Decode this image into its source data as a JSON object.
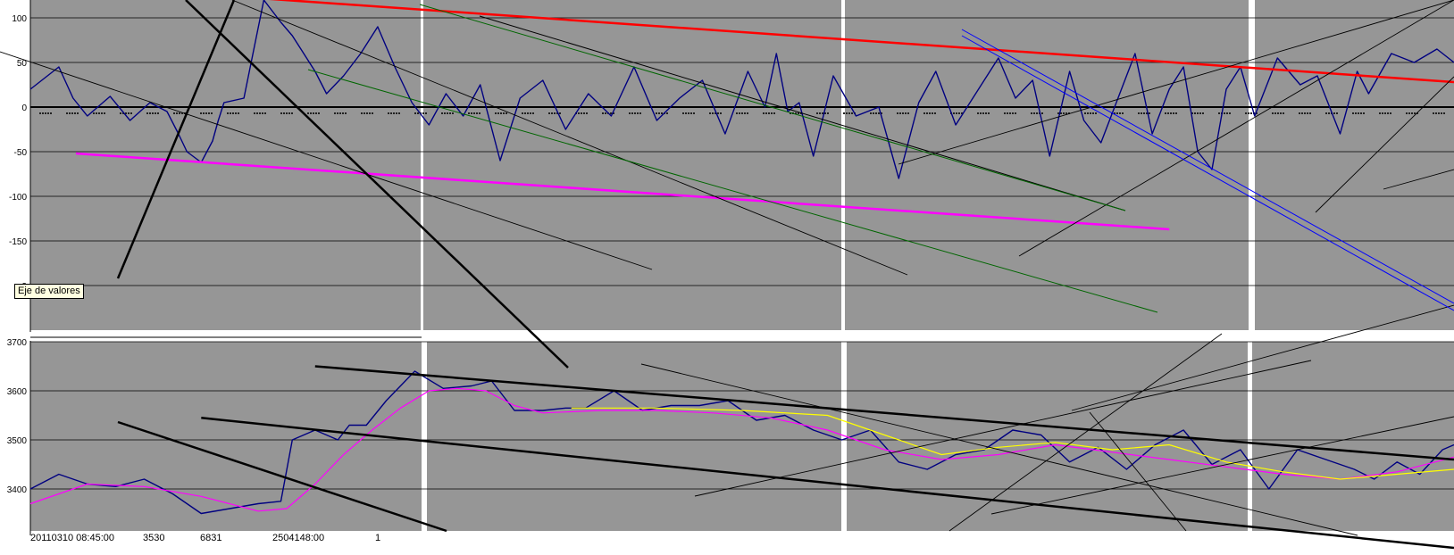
{
  "tooltip": "Eje de valores",
  "colors": {
    "panel_bg": "#969696",
    "price_line": "#000080",
    "ma_fast": "#ff00ff",
    "ma_slow": "#ffff00",
    "resistance": "#ff0000",
    "support": "#ff00ff",
    "channel_green": "#006600",
    "channel_blue": "#0000ff",
    "trendline": "#000000"
  },
  "bottom_date_labels": [
    "20110310 08:45:00",
    "3530",
    "6831",
    "2504148:00",
    "1"
  ],
  "chart_data": [
    {
      "type": "line",
      "subplot": "top oscillator",
      "ylim": [
        -250,
        100
      ],
      "yticks": [
        100,
        50,
        0,
        -50,
        -100,
        -150,
        -200
      ],
      "ytick_labels": [
        "100",
        "50",
        "0",
        "-50",
        "-100",
        "-150",
        "-2"
      ],
      "grid": true,
      "panel_breaks": 4,
      "series": [
        {
          "role": "oscillator",
          "color": "#000080",
          "x": [
            0,
            10,
            15,
            20,
            28,
            35,
            42,
            48,
            52,
            55,
            60,
            64,
            66,
            68,
            75,
            82,
            88,
            92,
            95,
            100,
            104,
            110,
            116,
            122,
            128,
            134,
            140,
            146,
            152,
            158,
            165,
            172,
            180,
            188,
            196,
            204,
            212,
            220,
            228,
            236,
            244,
            252,
            258,
            262,
            266,
            270,
            275,
            282,
            290,
            298,
            305,
            312,
            318,
            325,
            332,
            340,
            346,
            352,
            358,
            365,
            370,
            376,
            382,
            388,
            394,
            400,
            405,
            410,
            415,
            420,
            425,
            430,
            438,
            446,
            452,
            460,
            466,
            470,
            478,
            486,
            494,
            500
          ],
          "y": [
            20,
            45,
            10,
            -10,
            12,
            -15,
            5,
            -5,
            -30,
            -50,
            -62,
            -38,
            -15,
            5,
            10,
            120,
            95,
            80,
            65,
            40,
            15,
            35,
            60,
            90,
            45,
            5,
            -20,
            15,
            -10,
            25,
            -60,
            10,
            30,
            -25,
            15,
            -10,
            45,
            -15,
            10,
            30,
            -30,
            40,
            0,
            60,
            -5,
            5,
            -55,
            35,
            -10,
            0,
            -80,
            5,
            40,
            -20,
            15,
            55,
            10,
            30,
            -55,
            40,
            -15,
            -40,
            10,
            60,
            -30,
            20,
            45,
            -50,
            -70,
            20,
            45,
            -10,
            55,
            25,
            35,
            -30,
            40,
            15,
            60,
            50,
            65,
            50
          ]
        },
        {
          "role": "resistance",
          "color": "#ff0000",
          "x": [
            0,
            500
          ],
          "y": [
            140,
            28
          ]
        },
        {
          "role": "support",
          "color": "#ff00ff",
          "x": [
            16,
            400
          ],
          "y": [
            -52,
            -137
          ]
        }
      ]
    },
    {
      "type": "line",
      "subplot": "bottom price",
      "ylim": [
        3275,
        3700
      ],
      "yticks": [
        3700,
        3600,
        3500,
        3400
      ],
      "ytick_labels": [
        "3700",
        "3600",
        "3500",
        "3400"
      ],
      "grid": true,
      "series": [
        {
          "role": "price",
          "color": "#000080",
          "x": [
            0,
            10,
            20,
            30,
            40,
            50,
            60,
            70,
            80,
            88,
            92,
            100,
            108,
            112,
            118,
            125,
            135,
            145,
            155,
            162,
            170,
            180,
            188,
            195,
            205,
            215,
            225,
            235,
            245,
            255,
            265,
            275,
            285,
            295,
            305,
            315,
            325,
            335,
            345,
            355,
            365,
            375,
            385,
            395,
            405,
            415,
            425,
            435,
            445,
            455,
            465,
            472,
            480,
            488,
            496,
            500
          ],
          "y": [
            3400,
            3430,
            3410,
            3405,
            3420,
            3390,
            3350,
            3360,
            3370,
            3375,
            3500,
            3520,
            3500,
            3530,
            3530,
            3580,
            3640,
            3605,
            3610,
            3620,
            3560,
            3560,
            3565,
            3565,
            3600,
            3560,
            3570,
            3570,
            3580,
            3540,
            3550,
            3520,
            3500,
            3520,
            3455,
            3440,
            3470,
            3480,
            3520,
            3510,
            3455,
            3485,
            3440,
            3490,
            3520,
            3450,
            3480,
            3400,
            3480,
            3460,
            3440,
            3420,
            3455,
            3430,
            3480,
            3490
          ]
        },
        {
          "role": "moving average (magenta)",
          "color": "#ff00ff",
          "x": [
            0,
            20,
            40,
            60,
            80,
            90,
            100,
            110,
            120,
            130,
            140,
            150,
            160,
            170,
            180,
            200,
            220,
            240,
            260,
            280,
            300,
            320,
            340,
            360,
            380,
            400,
            420,
            440,
            460,
            480,
            500
          ],
          "y": [
            3370,
            3410,
            3405,
            3385,
            3355,
            3360,
            3410,
            3470,
            3520,
            3565,
            3600,
            3605,
            3600,
            3570,
            3555,
            3560,
            3560,
            3555,
            3545,
            3520,
            3480,
            3460,
            3470,
            3490,
            3475,
            3460,
            3445,
            3430,
            3420,
            3435,
            3465
          ]
        },
        {
          "role": "moving average (yellow)",
          "color": "#ffff00",
          "x": [
            190,
            220,
            250,
            280,
            300,
            320,
            340,
            360,
            380,
            400,
            420,
            440,
            460,
            480,
            500
          ],
          "y": [
            3565,
            3565,
            3560,
            3550,
            3510,
            3470,
            3485,
            3495,
            3480,
            3490,
            3455,
            3435,
            3420,
            3430,
            3440
          ]
        },
        {
          "role": "channel upper",
          "color": "#000000",
          "x": [
            100,
            500
          ],
          "y": [
            3650,
            3460
          ]
        },
        {
          "role": "channel lower",
          "color": "#000000",
          "x": [
            60,
            500
          ],
          "y": [
            3545,
            3280
          ]
        }
      ]
    }
  ]
}
